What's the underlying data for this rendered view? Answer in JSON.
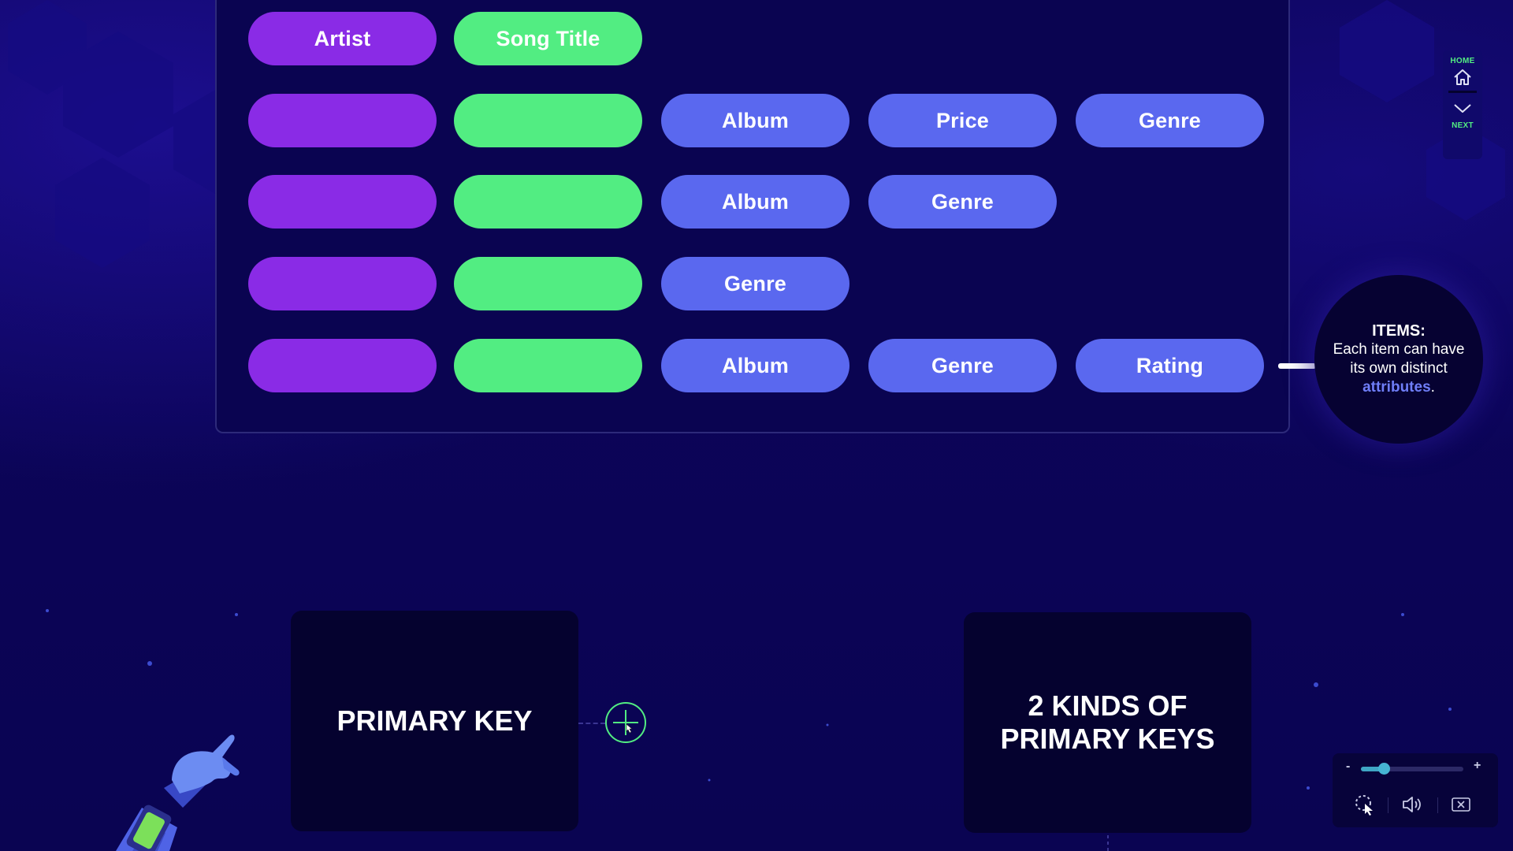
{
  "table": {
    "header_row": [
      {
        "label": "Artist",
        "color": "purple"
      },
      {
        "label": "Song Title",
        "color": "green"
      }
    ],
    "rows": [
      {
        "attributes": [
          "Album",
          "Price",
          "Genre"
        ]
      },
      {
        "attributes": [
          "Album",
          "Genre"
        ]
      },
      {
        "attributes": [
          "Genre"
        ]
      },
      {
        "attributes": [
          "Album",
          "Genre",
          "Rating"
        ]
      }
    ]
  },
  "callout": {
    "heading": "ITEMS:",
    "text_before": "Each item can have its own distinct",
    "accent": "attributes",
    "text_after": "."
  },
  "nav": {
    "home_label": "HOME",
    "next_label": "NEXT"
  },
  "cards": {
    "left_title": "PRIMARY KEY",
    "right_line1": "2 KINDS OF",
    "right_line2": "PRIMARY KEYS"
  },
  "controls": {
    "minus": "-",
    "plus": "+",
    "volume_level": 0.22
  },
  "colors": {
    "purple": "#8a2be6",
    "green": "#52ed82",
    "blue": "#5a68ef",
    "accent_text": "#6f7ef8",
    "background": "#0c0459"
  },
  "icons": [
    "home-icon",
    "chevron-down-icon",
    "plus-icon",
    "cursor-icon",
    "volume-icon",
    "close-captions-icon",
    "robot-hand-illustration"
  ]
}
